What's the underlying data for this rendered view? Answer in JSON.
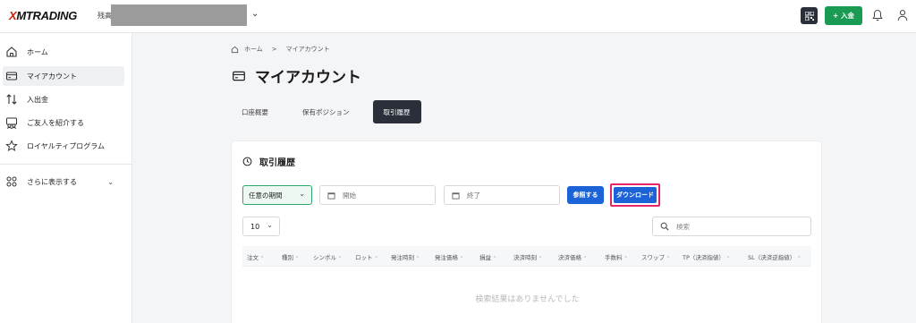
{
  "header": {
    "logo_mark": "X",
    "logo_text": "MTRADING",
    "balance_label": "残高",
    "deposit_label": "+ 入金"
  },
  "sidebar": {
    "items": [
      {
        "label": "ホーム",
        "icon": "home-icon"
      },
      {
        "label": "マイアカウント",
        "icon": "card-icon",
        "active": true
      },
      {
        "label": "入出金",
        "icon": "transfer-arrows-icon"
      },
      {
        "label": "ご友人を紹介する",
        "icon": "refer-friends-icon"
      },
      {
        "label": "ロイヤルティプログラム",
        "icon": "star-icon"
      }
    ],
    "more_label": "さらに表示する"
  },
  "breadcrumb": {
    "home": "ホーム",
    "separator": ">",
    "current": "マイアカウント"
  },
  "page": {
    "title": "マイアカウント"
  },
  "tabs": [
    {
      "label": "口座概要"
    },
    {
      "label": "保有ポジション"
    },
    {
      "label": "取引履歴",
      "active": true
    }
  ],
  "history": {
    "title": "取引履歴",
    "period_select": "任意の期間",
    "start_placeholder": "開始",
    "end_placeholder": "終了",
    "reference_button": "参照する",
    "download_button": "ダウンロード",
    "page_size": "10",
    "search_placeholder": "検索",
    "columns": [
      "注文",
      "種別",
      "シンボル",
      "ロット",
      "発注時刻",
      "発注価格",
      "損益",
      "決済時刻",
      "決済価格",
      "手数料",
      "スワップ",
      "TP（決済指値）",
      "SL（決済逆指値）"
    ],
    "empty_message": "検索結果はありませんでした"
  },
  "colors": {
    "accent_green": "#199b53",
    "accent_blue": "#1d63d8",
    "highlight_pink": "#e6246a",
    "dark": "#2a2f3a"
  }
}
